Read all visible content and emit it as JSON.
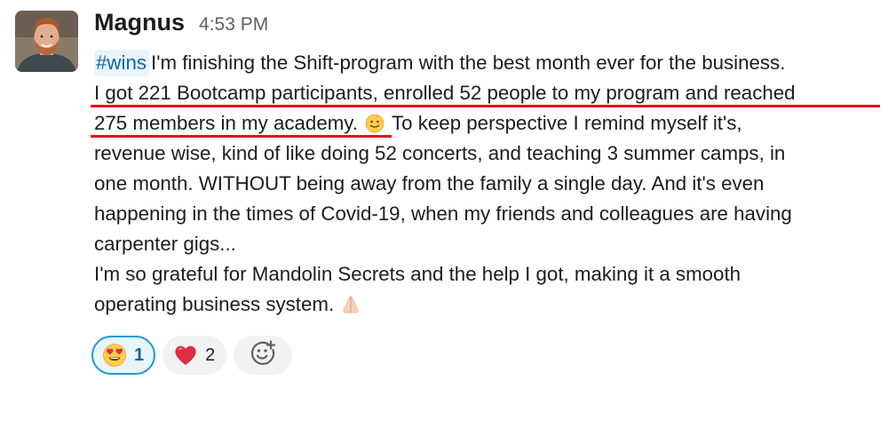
{
  "message": {
    "sender": "Magnus",
    "timestamp": "4:53 PM",
    "channel_tag": "#wins",
    "lines": [
      "I'm finishing the Shift-program with the best month ever for the business.",
      "I got 221 Bootcamp participants, enrolled 52 people to my program and reached",
      "275 members in my academy.",
      " To keep perspective I remind myself it's,",
      "revenue wise, kind of like doing 52 concerts, and teaching 3 summer camps, in",
      "one month. WITHOUT being away from the family a single day. And it's even",
      "happening in the times of Covid-19, when my friends and colleagues are having",
      "carpenter gigs...",
      "I'm so grateful for Mandolin Secrets and the help I got, making it a smooth",
      "operating business system."
    ],
    "inline_emoji": [
      "slightly-smiling-face-icon",
      "folded-hands-icon"
    ]
  },
  "reactions": [
    {
      "emoji": "heart-eyes-icon",
      "count": "1",
      "selected": true
    },
    {
      "emoji": "red-heart-icon",
      "count": "2",
      "selected": false
    }
  ],
  "add_reaction": {
    "icon": "add-reaction-icon"
  },
  "colors": {
    "text": "#1d1c1d",
    "timestamp": "#616061",
    "channel_bg": "#e8f5fa",
    "channel_text": "#1264a3",
    "underline": "#e0121b",
    "reaction_active_border": "#1d9bd1",
    "reaction_bg": "#f2f2f2"
  }
}
